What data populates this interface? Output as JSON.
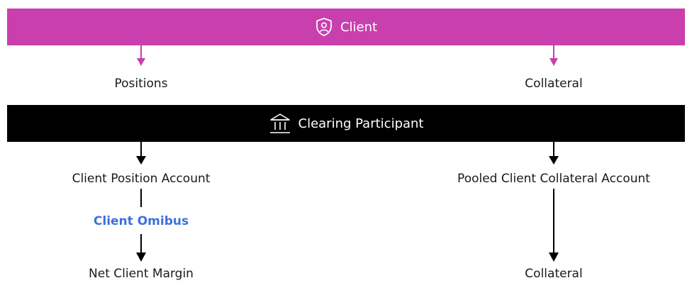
{
  "client_band": {
    "label": "Client",
    "icon": "shield-user-icon",
    "color": "#c93fae"
  },
  "clearing_band": {
    "label": "Clearing Participant",
    "icon": "bank-building-icon",
    "color": "#000000"
  },
  "left_column": {
    "positions": "Positions",
    "client_position_account": "Client Position Account",
    "client_omnibus": "Client Omibus",
    "net_client_margin": "Net Client Margin"
  },
  "right_column": {
    "collateral_top": "Collateral",
    "pooled_account": "Pooled Client Collateral Account",
    "collateral_bottom": "Collateral"
  },
  "colors": {
    "accent_blue": "#3e6fe0",
    "arrow_pink": "#c93fae",
    "arrow_black": "#000000"
  }
}
